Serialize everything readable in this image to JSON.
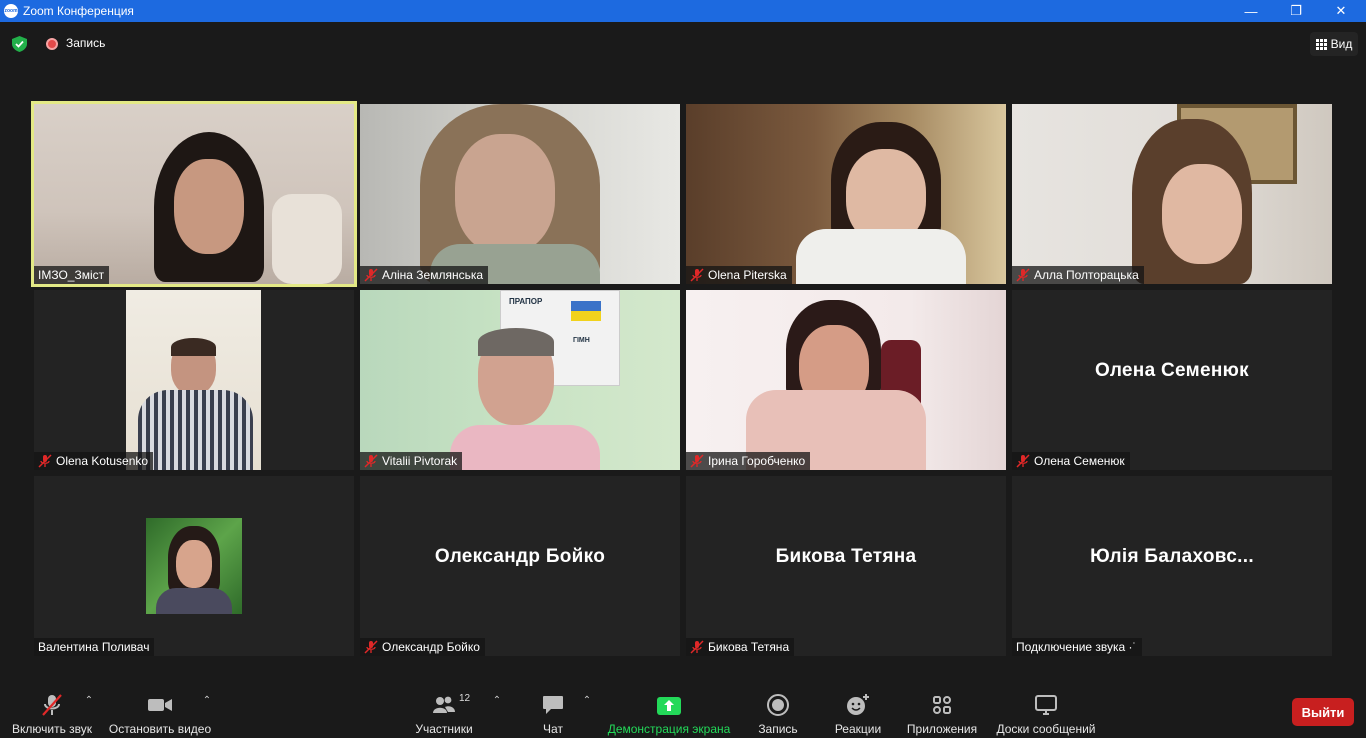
{
  "window": {
    "title": "Zoom Конференция",
    "logo_text": "zoom",
    "controls": [
      "—",
      "❐",
      "✕"
    ]
  },
  "topbar": {
    "recording_label": "Запись",
    "view_label": "Вид"
  },
  "participants": [
    {
      "name": "ІМЗО_Зміст",
      "muted": false,
      "video": true,
      "active_speaker": true
    },
    {
      "name": "Аліна Землянська",
      "muted": true,
      "video": true
    },
    {
      "name": "Olena Piterska",
      "muted": true,
      "video": true
    },
    {
      "name": "Алла Полторацька",
      "muted": true,
      "video": true
    },
    {
      "name": "Olena Kotusenko",
      "muted": true,
      "video": true
    },
    {
      "name": "Vitalii Pivtorak",
      "muted": true,
      "video": true,
      "poster_texts": [
        "ПРАПОР",
        "ГІМН"
      ]
    },
    {
      "name": "Ірина Горобченко",
      "muted": true,
      "video": true
    },
    {
      "name": "Олена Семенюк",
      "muted": true,
      "video": false,
      "display_name": "Олена Семенюк"
    },
    {
      "name": "Валентина Поливач",
      "muted": false,
      "video": false,
      "avatar": true
    },
    {
      "name": "Олександр Бойко",
      "muted": true,
      "video": false,
      "display_name": "Олександр Бойко"
    },
    {
      "name": "Бикова Тетяна",
      "muted": true,
      "video": false,
      "display_name": "Бикова Тетяна"
    },
    {
      "name": "Подключение звука ·˙",
      "muted": false,
      "video": false,
      "display_name": "Юлія Балаховс..."
    }
  ],
  "toolbar": {
    "mute_label": "Включить звук",
    "video_label": "Остановить видео",
    "participants_label": "Участники",
    "participants_count": "12",
    "chat_label": "Чат",
    "share_label": "Демонстрация экрана",
    "record_label": "Запись",
    "reactions_label": "Реакции",
    "apps_label": "Приложения",
    "whiteboards_label": "Доски сообщений",
    "leave_label": "Выйти"
  },
  "colors": {
    "titlebar": "#1d6ae0",
    "background": "#1a1a1a",
    "tile": "#232323",
    "active_border": "#e3e986",
    "share_green": "#23d959",
    "leave_red": "#c81f1f",
    "muted_red": "#e02828"
  }
}
